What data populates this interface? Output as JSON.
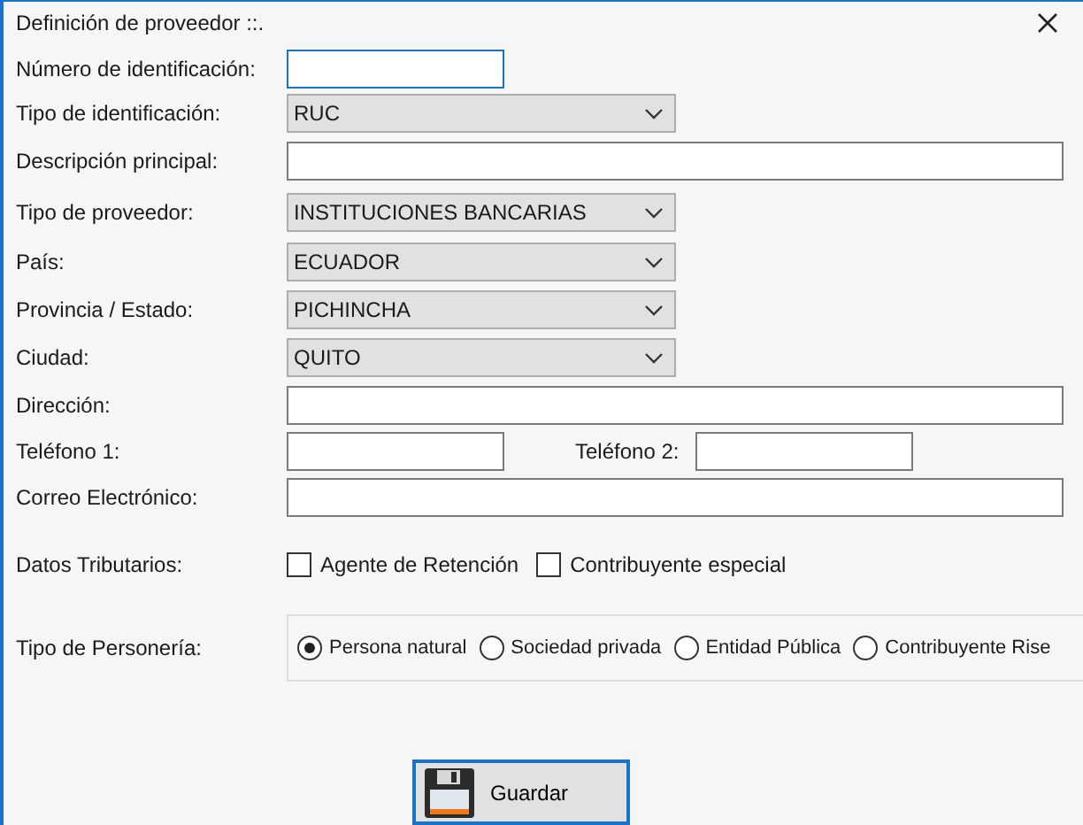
{
  "window": {
    "title": "Definición de proveedor ::."
  },
  "fields": [
    {
      "kind": "text",
      "label": "Número de identificación:",
      "focused": true,
      "wide": false
    },
    {
      "kind": "select",
      "label": "Tipo de identificación:",
      "value": "RUC"
    },
    {
      "kind": "text",
      "label": "Descripción principal:",
      "focused": false,
      "wide": true
    },
    {
      "kind": "select",
      "label": "Tipo de proveedor:",
      "value": "INSTITUCIONES BANCARIAS"
    },
    {
      "kind": "select",
      "label": "País:",
      "value": "ECUADOR"
    },
    {
      "kind": "select",
      "label": "Provincia / Estado:",
      "value": "PICHINCHA"
    },
    {
      "kind": "select",
      "label": "Ciudad:",
      "value": "QUITO"
    },
    {
      "kind": "text",
      "label": "Dirección:",
      "focused": false,
      "wide": true
    },
    {
      "kind": "phones",
      "label": "Teléfono 1:",
      "label2": "Teléfono 2:"
    },
    {
      "kind": "text",
      "label": "Correo Electrónico:",
      "focused": false,
      "wide": true
    },
    {
      "kind": "checks",
      "label": "Datos Tributarios:",
      "options": [
        {
          "label": "Agente de Retención",
          "checked": false
        },
        {
          "label": "Contribuyente especial",
          "checked": false
        }
      ]
    },
    {
      "kind": "radios",
      "label": "Tipo de Personería:",
      "options": [
        {
          "label": "Persona natural",
          "selected": true
        },
        {
          "label": "Sociedad privada",
          "selected": false
        },
        {
          "label": "Entidad Pública",
          "selected": false
        },
        {
          "label": "Contribuyente Rise",
          "selected": false
        }
      ]
    }
  ],
  "save_button": {
    "label": "Guardar"
  }
}
